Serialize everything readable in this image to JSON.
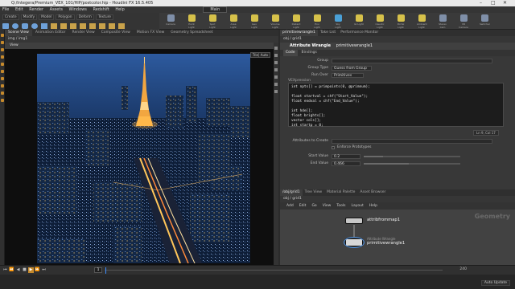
{
  "window": {
    "title": "Q:/Integera/Premium_VEX_101/HIP/postcolor.hip - Houdini FX 16.5.405",
    "controls": [
      "–",
      "□",
      "✕"
    ]
  },
  "menubar": [
    "File",
    "Edit",
    "Render",
    "Assets",
    "Windows",
    "Redshift",
    "Help"
  ],
  "desktop": "Main",
  "shelf_left_tabs": [
    "Create",
    "Modify",
    "Model",
    "Polygon",
    "Deform",
    "Texture"
  ],
  "shelf_tools": [
    {
      "label": "Camera",
      "color": "#7f8fa8"
    },
    {
      "label": "Point Light",
      "color": "#d6c14a"
    },
    {
      "label": "Spot Light",
      "color": "#d6c14a"
    },
    {
      "label": "Area Light",
      "color": "#d6c14a"
    },
    {
      "label": "Geo Light",
      "color": "#d6c14a"
    },
    {
      "label": "Volume Light",
      "color": "#d6c14a"
    },
    {
      "label": "Distant Light",
      "color": "#d6c14a"
    },
    {
      "label": "Env Light",
      "color": "#d6c14a"
    },
    {
      "label": "Sky Light",
      "color": "#4aa0d6"
    },
    {
      "label": "GI Light",
      "color": "#d6c14a"
    },
    {
      "label": "Caustic Light",
      "color": "#d6c14a"
    },
    {
      "label": "Portal Light",
      "color": "#d6c14a"
    },
    {
      "label": "Ambient Light",
      "color": "#d6c14a"
    },
    {
      "label": "Stereo Cam",
      "color": "#7f8fa8"
    },
    {
      "label": "VR Camera",
      "color": "#7f8fa8"
    },
    {
      "label": "Switcher",
      "color": "#7f8fa8"
    }
  ],
  "viewport_tabs": [
    "Scene View",
    "Animation Editor",
    "Render View",
    "Composite View",
    "Motion FX View",
    "Geometry Spreadsheet"
  ],
  "viewport_path": "img  /  img1",
  "viewport_header": "View",
  "viewport_badges": [
    "Trie",
    "Auto"
  ],
  "param_tabs": [
    "primitivewrangle1",
    "Take List",
    "Performance Monitor"
  ],
  "param_path": "obj  /  grid1",
  "param_node": {
    "type_label": "Attribute Wrangle",
    "name": "primitivewrangle1"
  },
  "param_subtabs": [
    "Code",
    "Bindings"
  ],
  "params": {
    "group_label": "Group",
    "group_value": "",
    "group_type_label": "Group Type",
    "group_type_value": "Guess from Group",
    "run_over_label": "Run Over",
    "run_over_value": "Primitives",
    "vexpression_label": "VEXpression",
    "vex_code": "int npts[] = primpoints(0, @primnum);\n\nfloat startval = chf(\"Start_Value\");\nfloat endval = chf(\"End_Value\");\n\nint hde[];\nfloat brights[];\nvector cols[];\nint startp = 0;",
    "code_status": "Ln 9, Col 17",
    "attrs_create_label": "Attributes to Create",
    "enforce_label": "Enforce Prototypes",
    "start_label": "Start Value",
    "start_value": "0.2",
    "start_fraction": 0.2,
    "end_label": "End Value",
    "end_value": "0.466",
    "end_fraction": 0.466
  },
  "network_tabs": [
    "/obj/grid1",
    "Tree View",
    "Material Palette",
    "Asset Browser"
  ],
  "network_path": "obj  /  grid1",
  "network_menu": [
    "Add",
    "Edit",
    "Go",
    "View",
    "Tools",
    "Layout",
    "Help"
  ],
  "network_context": "Geometry",
  "nodes": [
    {
      "name": "attribfrommap1",
      "type": "",
      "color": "#c8c8c8"
    },
    {
      "name": "primitivewrangle1",
      "type": "Attribute Wrangle",
      "color": "#d7d7d7"
    }
  ],
  "timeline": {
    "frame": "1",
    "buttons": [
      "⏮",
      "⏪",
      "◀",
      "■",
      "▶",
      "⏩",
      "⏭"
    ],
    "end_frame": "240"
  },
  "status": {
    "auto_update": "Auto Update"
  }
}
